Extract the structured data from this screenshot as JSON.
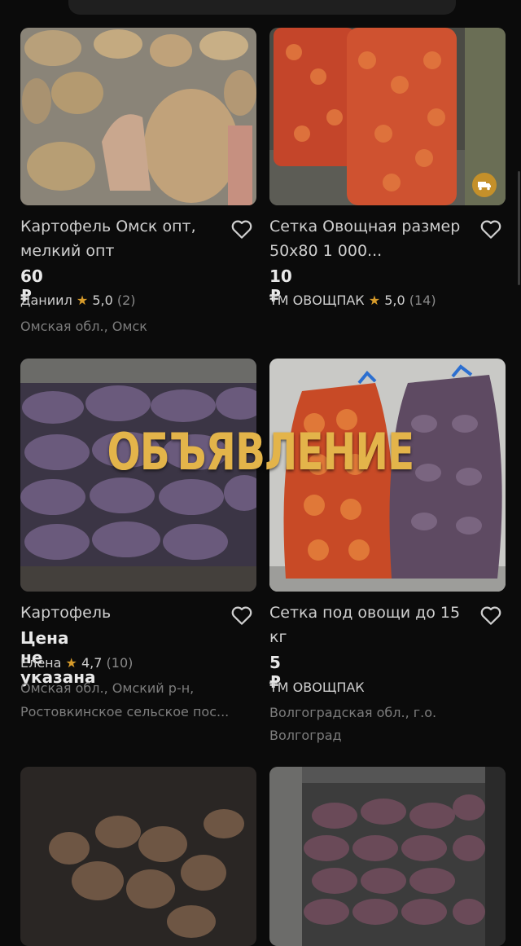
{
  "overlay": {
    "text": "ОБЪЯВЛЕНИЕ"
  },
  "listings": [
    {
      "title": "Картофель Омск опт, мелкий опт",
      "price": "60 ₽",
      "seller": "Даниил",
      "rating": "5,0",
      "reviews": "(2)",
      "location": "Омская обл., Омск"
    },
    {
      "title": "Сетка Овощная размер 50х80 1 000...",
      "price": "10 ₽",
      "seller": "ТМ ОВОЩПАК",
      "rating": "5,0",
      "reviews": "(14)",
      "delivery_icon": "truck-icon"
    },
    {
      "title": "Картофель",
      "price": "Цена не указана",
      "seller": "Елена",
      "rating": "4,7",
      "reviews": "(10)",
      "location": "Омская обл., Омский р-н,",
      "location2": "Ростовкинское сельское пос..."
    },
    {
      "title": "Сетка под овощи до 15 кг",
      "price": "5 ₽",
      "seller": "ТМ ОВОЩПАК",
      "location": "Волгоградская обл., г.о.",
      "location2": "Волгоград"
    }
  ],
  "colors": {
    "background": "#0b0b0b",
    "star": "#d79b2a",
    "overlay_text": "#e3b44a"
  },
  "icons": {
    "favorite": "heart-icon",
    "rating": "star-icon"
  }
}
